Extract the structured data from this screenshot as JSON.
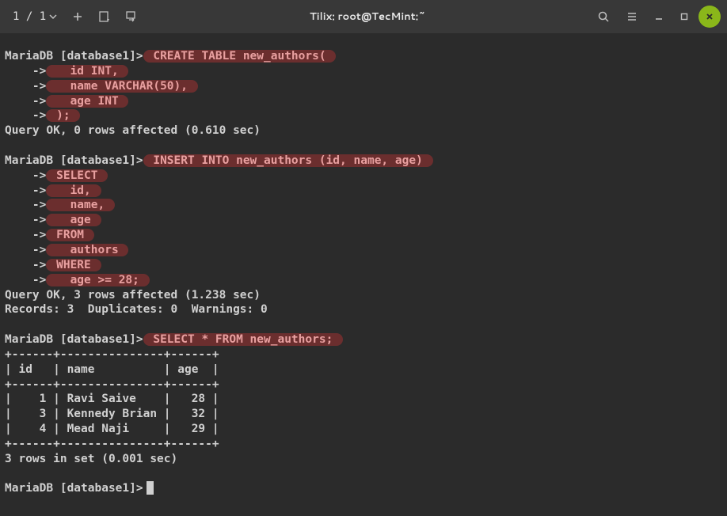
{
  "titlebar": {
    "tab_counter": "1 / 1",
    "title": "Tilix: root@TecMint:~"
  },
  "terminal": {
    "prompt": "MariaDB [database1]>",
    "arrow": "    ->",
    "block1": {
      "cmd": " CREATE TABLE new_authors( ",
      "l1": "   id INT, ",
      "l2": "   name VARCHAR(50), ",
      "l3": "   age INT ",
      "l4": " ); ",
      "result": "Query OK, 0 rows affected (0.610 sec)"
    },
    "block2": {
      "cmd": " INSERT INTO new_authors (id, name, age) ",
      "l1": " SELECT ",
      "l2": "   id, ",
      "l3": "   name, ",
      "l4": "   age ",
      "l5": " FROM ",
      "l6": "   authors ",
      "l7": " WHERE ",
      "l8": "   age >= 28; ",
      "result1": "Query OK, 3 rows affected (1.238 sec)",
      "result2": "Records: 3  Duplicates: 0  Warnings: 0"
    },
    "block3": {
      "cmd": " SELECT * FROM new_authors; ",
      "border": "+------+---------------+------+",
      "header": "| id   | name          | age  |",
      "row1": "|    1 | Ravi Saive    |   28 |",
      "row2": "|    3 | Kennedy Brian |   32 |",
      "row3": "|    4 | Mead Naji     |   29 |",
      "result": "3 rows in set (0.001 sec)"
    },
    "cursor_prompt": "MariaDB [database1]>"
  },
  "chart_data": {
    "type": "table",
    "title": "new_authors",
    "columns": [
      "id",
      "name",
      "age"
    ],
    "rows": [
      {
        "id": 1,
        "name": "Ravi Saive",
        "age": 28
      },
      {
        "id": 3,
        "name": "Kennedy Brian",
        "age": 32
      },
      {
        "id": 4,
        "name": "Mead Naji",
        "age": 29
      }
    ]
  }
}
